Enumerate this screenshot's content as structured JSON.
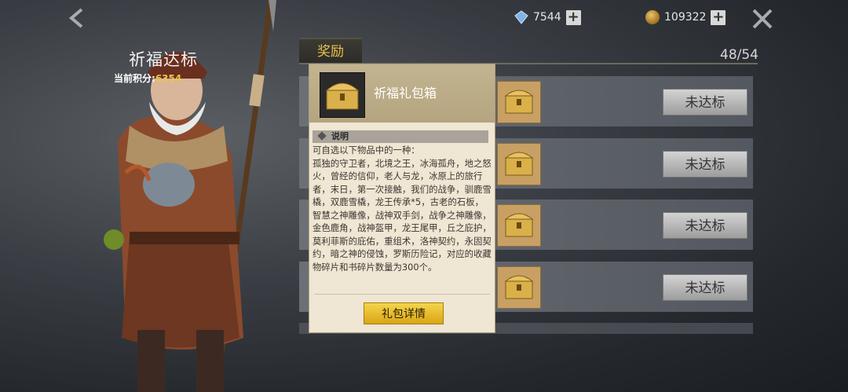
{
  "topbar": {
    "gem_count": "7544",
    "coin_count": "109322",
    "plus_label": "+"
  },
  "event": {
    "title": "祈福达标",
    "score_label": "当前积分:",
    "score_value": "6354"
  },
  "rewards": {
    "tab_label": "奖励",
    "progress": "48/54",
    "rows": [
      {
        "button": "未达标"
      },
      {
        "button": "未达标"
      },
      {
        "button": "未达标"
      },
      {
        "button": "未达标"
      }
    ]
  },
  "popup": {
    "title": "祈福礼包箱",
    "section_label": "说明",
    "description": "可自选以下物品中的一种：\n孤独的守卫者，北境之王，冰海孤舟，地之怒火，曾经的信仰，老人与龙，冰原上的旅行者，末日，第一次接触，我们的战争，驯鹿雪橇，双鹿雪橇，龙王传承*5，古老的石板，智慧之神雕像，战神双手剑，战争之神雕像，金色鹿角，战神盔甲，龙王尾甲，丘之庇护，莫利菲斯的庇佑，重组术，洛神契约，永固契约，暗之神的侵蚀，罗斯历险记，对应的收藏物碎片和书碎片数量为300个。",
    "detail_button": "礼包详情"
  },
  "colors": {
    "accent_gold": "#e9c64d",
    "button_yellow": "#f4d54c"
  }
}
